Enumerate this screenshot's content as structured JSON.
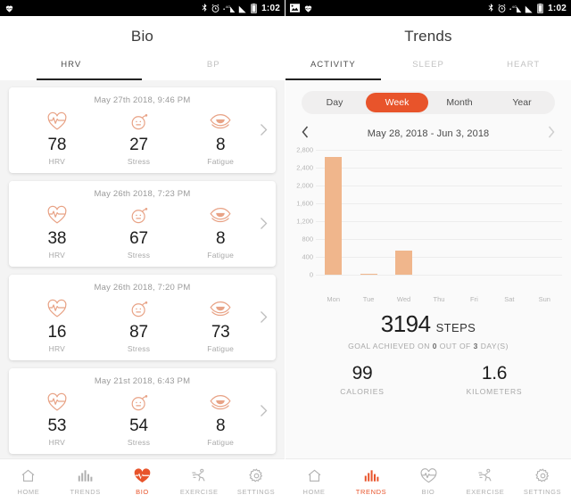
{
  "accent": "#e8542b",
  "bar_color": "#f0b68c",
  "icon_color": "#e8a285",
  "left": {
    "statusbar": {
      "icons": [
        "heart-app-icon",
        "bluetooth-icon",
        "alarm-icon",
        "mobile-data-4g-icon",
        "signal-icon",
        "battery-icon"
      ],
      "time": "1:02"
    },
    "title": "Bio",
    "tabs": [
      {
        "label": "HRV",
        "active": true
      },
      {
        "label": "BP",
        "active": false
      }
    ],
    "cards": [
      {
        "date": "May 27th 2018, 9:46 PM",
        "metrics": [
          {
            "icon": "heart-pulse-icon",
            "value": "78",
            "label": "HRV"
          },
          {
            "icon": "bomb-face-icon",
            "value": "27",
            "label": "Stress"
          },
          {
            "icon": "tired-eye-icon",
            "value": "8",
            "label": "Fatigue"
          }
        ]
      },
      {
        "date": "May 26th 2018, 7:23 PM",
        "metrics": [
          {
            "icon": "heart-pulse-icon",
            "value": "38",
            "label": "HRV"
          },
          {
            "icon": "bomb-face-icon",
            "value": "67",
            "label": "Stress"
          },
          {
            "icon": "tired-eye-icon",
            "value": "8",
            "label": "Fatigue"
          }
        ]
      },
      {
        "date": "May 26th 2018, 7:20 PM",
        "metrics": [
          {
            "icon": "heart-pulse-icon",
            "value": "16",
            "label": "HRV"
          },
          {
            "icon": "bomb-face-icon",
            "value": "87",
            "label": "Stress"
          },
          {
            "icon": "tired-eye-icon",
            "value": "73",
            "label": "Fatigue"
          }
        ]
      },
      {
        "date": "May 21st 2018, 6:43 PM",
        "metrics": [
          {
            "icon": "heart-pulse-icon",
            "value": "53",
            "label": "HRV"
          },
          {
            "icon": "bomb-face-icon",
            "value": "54",
            "label": "Stress"
          },
          {
            "icon": "tired-eye-icon",
            "value": "8",
            "label": "Fatigue"
          }
        ]
      }
    ],
    "bottomnav": [
      {
        "icon": "home-icon",
        "label": "HOME",
        "active": false
      },
      {
        "icon": "bar-chart-icon",
        "label": "TRENDS",
        "active": false
      },
      {
        "icon": "heart-pulse-icon",
        "label": "BIO",
        "active": true
      },
      {
        "icon": "running-icon",
        "label": "EXERCISE",
        "active": false
      },
      {
        "icon": "gear-icon",
        "label": "SETTINGS",
        "active": false
      }
    ]
  },
  "right": {
    "statusbar": {
      "icons": [
        "screenshot-icon",
        "heart-app-icon",
        "bluetooth-icon",
        "alarm-icon",
        "mobile-data-4g-icon",
        "signal-icon",
        "battery-icon"
      ],
      "time": "1:02"
    },
    "title": "Trends",
    "tabs": [
      {
        "label": "ACTIVITY",
        "active": true
      },
      {
        "label": "SLEEP",
        "active": false
      },
      {
        "label": "HEART",
        "active": false
      }
    ],
    "range_segments": [
      {
        "label": "Day",
        "active": false
      },
      {
        "label": "Week",
        "active": true
      },
      {
        "label": "Month",
        "active": false
      },
      {
        "label": "Year",
        "active": false
      }
    ],
    "datenav": {
      "prev_icon": "chevron-left-icon",
      "label": "May 28, 2018 - Jun 3, 2018",
      "next_icon": "chevron-right-icon"
    },
    "summary": {
      "steps_value": "3194",
      "steps_unit": "STEPS",
      "goal_prefix": "GOAL ACHIEVED ON ",
      "goal_achieved": "0",
      "goal_middle": " OUT OF ",
      "goal_total": "3",
      "goal_suffix": " DAY(S)",
      "sub_stats": [
        {
          "value": "99",
          "label": "CALORIES"
        },
        {
          "value": "1.6",
          "label": "KILOMETERS"
        }
      ]
    },
    "bottomnav": [
      {
        "icon": "home-icon",
        "label": "HOME",
        "active": false
      },
      {
        "icon": "bar-chart-icon",
        "label": "TRENDS",
        "active": true
      },
      {
        "icon": "heart-pulse-icon",
        "label": "BIO",
        "active": false
      },
      {
        "icon": "running-icon",
        "label": "EXERCISE",
        "active": false
      },
      {
        "icon": "gear-icon",
        "label": "SETTINGS",
        "active": false
      }
    ]
  },
  "chart_data": {
    "type": "bar",
    "title": "",
    "xlabel": "",
    "ylabel": "",
    "categories": [
      "Mon",
      "Tue",
      "Wed",
      "Thu",
      "Fri",
      "Sat",
      "Sun"
    ],
    "values": [
      2640,
      20,
      535,
      0,
      0,
      0,
      0
    ],
    "ylim": [
      0,
      2800
    ],
    "yticks": [
      0,
      400,
      800,
      1200,
      1600,
      2000,
      2400,
      2800
    ],
    "ytick_labels": [
      "0",
      "400",
      "800",
      "1,200",
      "1,600",
      "2,000",
      "2,400",
      "2,800"
    ],
    "grid": true,
    "legend": "none",
    "series_name": "Steps"
  }
}
